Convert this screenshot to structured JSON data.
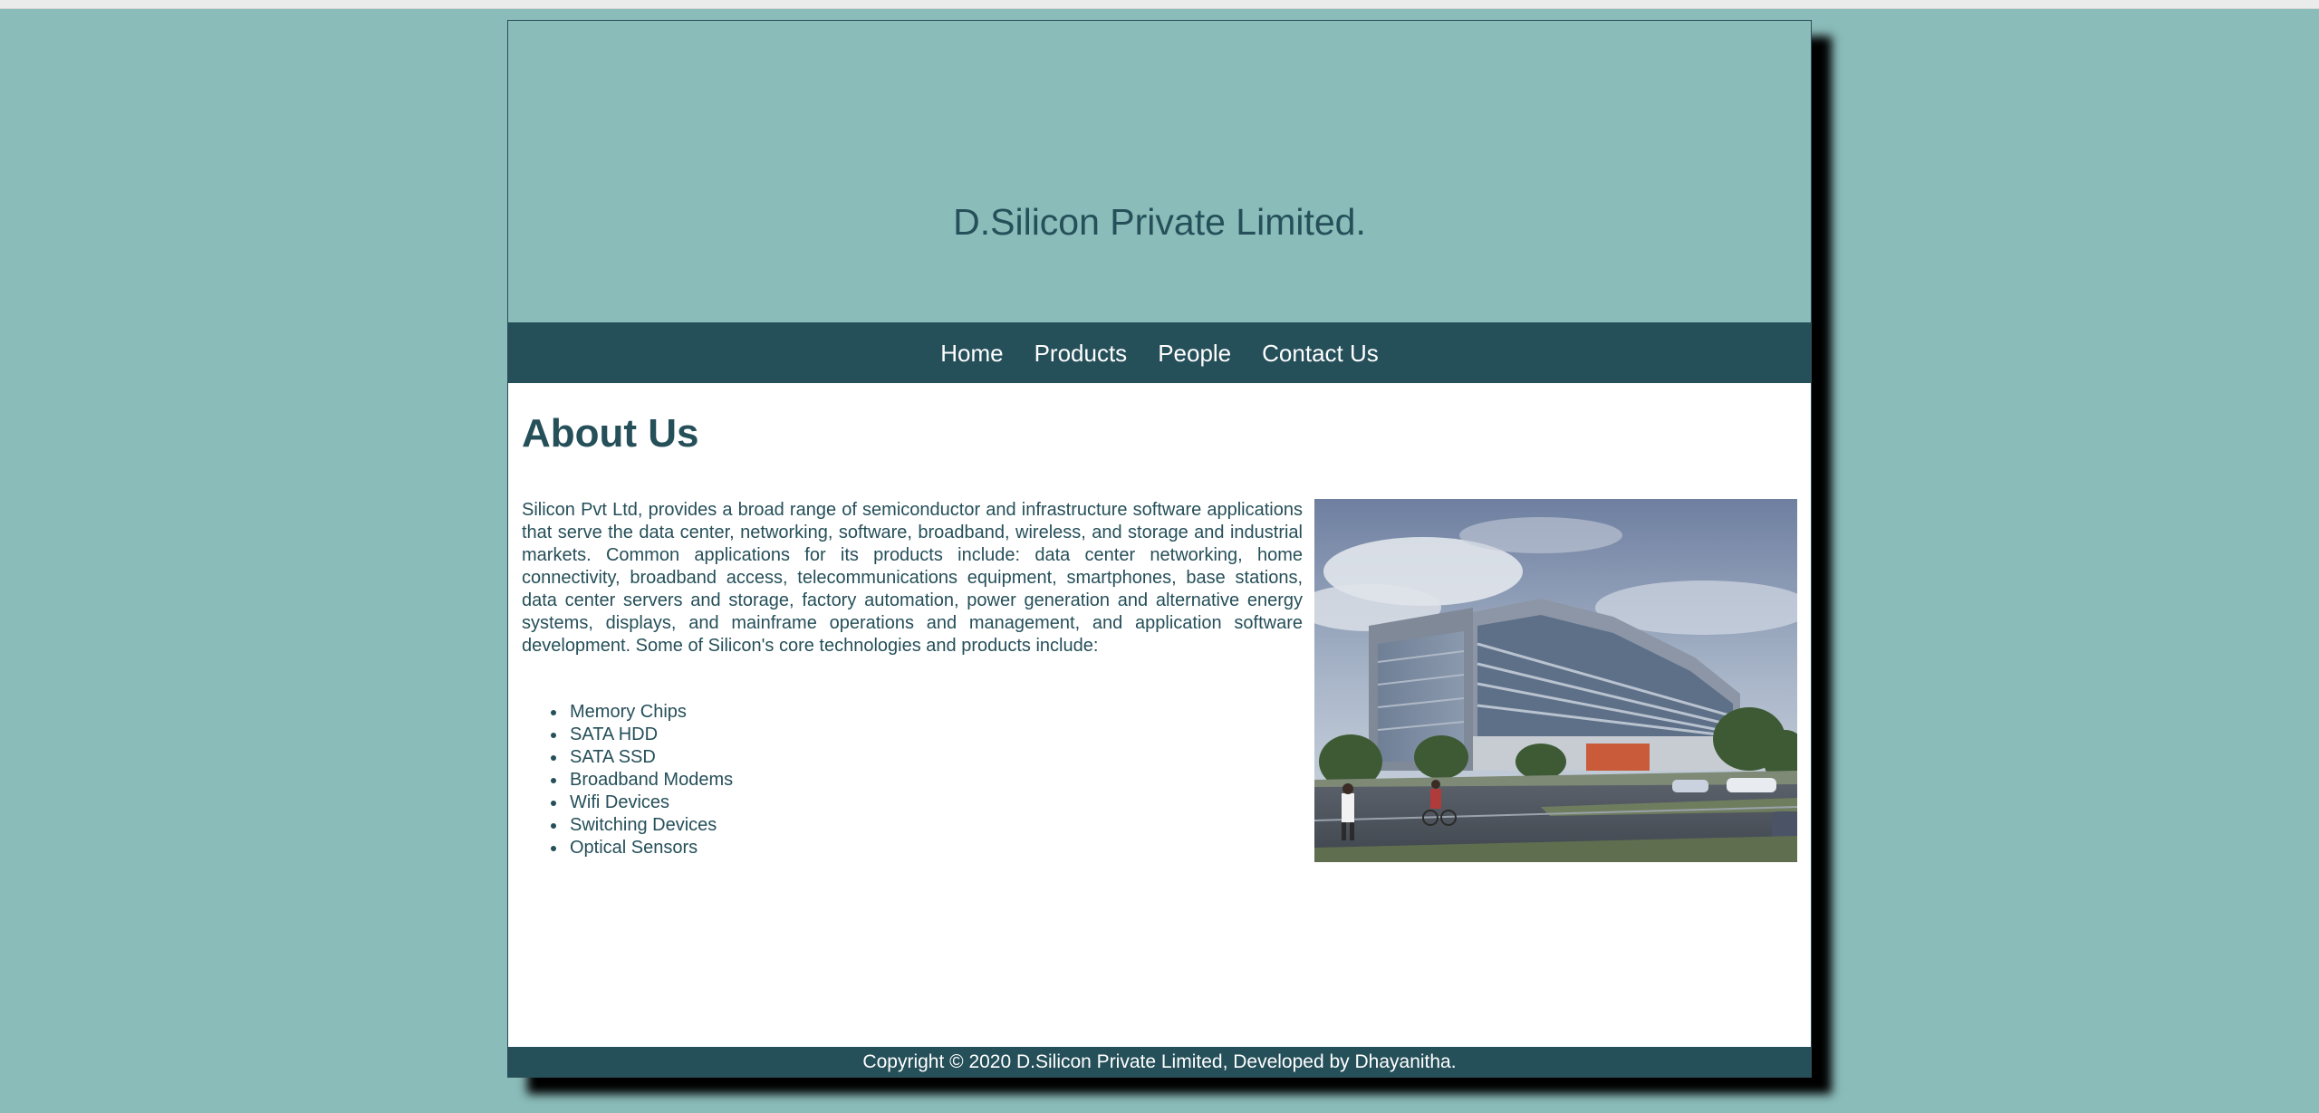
{
  "site": {
    "title": "D.Silicon Private Limited."
  },
  "nav": {
    "items": [
      "Home",
      "Products",
      "People",
      "Contact Us"
    ]
  },
  "main": {
    "heading": "About Us",
    "intro": "Silicon Pvt Ltd, provides a broad range of semiconductor and infrastructure software applications that serve the data center, networking, software, broadband, wireless, and storage and industrial markets. Common applications for its products include: data center networking, home connectivity, broadband access, telecommunications equipment, smartphones, base stations, data center servers and storage, factory automation, power generation and alternative energy systems, displays, and mainframe operations and management, and application software development. Some of Silicon's core technologies and products include:",
    "products": [
      "Memory Chips",
      "SATA HDD",
      "SATA SSD",
      "Broadband Modems",
      "Wifi Devices",
      "Switching Devices",
      "Optical Sensors"
    ]
  },
  "footer": {
    "text": "Copyright © 2020 D.Silicon Private Limited, Developed by Dhayanitha."
  },
  "colors": {
    "background": "#8abcba",
    "brand_dark": "#254f59",
    "content_bg": "#ffffff"
  }
}
